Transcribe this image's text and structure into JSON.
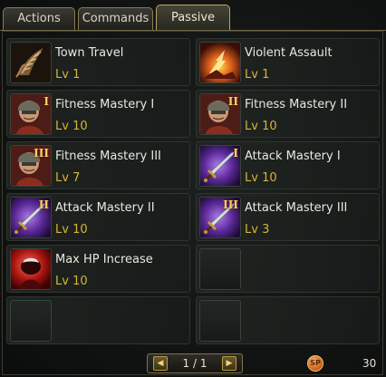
{
  "tabs": [
    {
      "label": "Actions"
    },
    {
      "label": "Commands"
    },
    {
      "label": "Passive"
    }
  ],
  "active_tab": "Passive",
  "skills": [
    {
      "name": "Town Travel",
      "level": "Lv 1",
      "icon": "town-travel-icon"
    },
    {
      "name": "Violent Assault",
      "level": "Lv 1",
      "icon": "violent-assault-icon"
    },
    {
      "name": "Fitness Mastery I",
      "level": "Lv 10",
      "icon": "fitness-mastery-icon",
      "rank": "I"
    },
    {
      "name": "Fitness Mastery II",
      "level": "Lv 10",
      "icon": "fitness-mastery-icon",
      "rank": "II"
    },
    {
      "name": "Fitness Mastery III",
      "level": "Lv 7",
      "icon": "fitness-mastery-icon",
      "rank": "III"
    },
    {
      "name": "Attack Mastery I",
      "level": "Lv 10",
      "icon": "attack-mastery-icon",
      "rank": "I"
    },
    {
      "name": "Attack Mastery II",
      "level": "Lv 10",
      "icon": "attack-mastery-icon",
      "rank": "II"
    },
    {
      "name": "Attack Mastery III",
      "level": "Lv 3",
      "icon": "attack-mastery-icon",
      "rank": "III"
    },
    {
      "name": "Max HP Increase",
      "level": "Lv 10",
      "icon": "max-hp-increase-icon"
    }
  ],
  "empty_slots": 3,
  "pager": {
    "text": "1 / 1",
    "prev_icon": "arrow-left-icon",
    "next_icon": "arrow-right-icon"
  },
  "skill_points": {
    "badge": "SP",
    "value": "30"
  },
  "colors": {
    "level_text": "#d8b437",
    "name_text": "#e9e7df",
    "tab_border": "#8a7a4e"
  }
}
